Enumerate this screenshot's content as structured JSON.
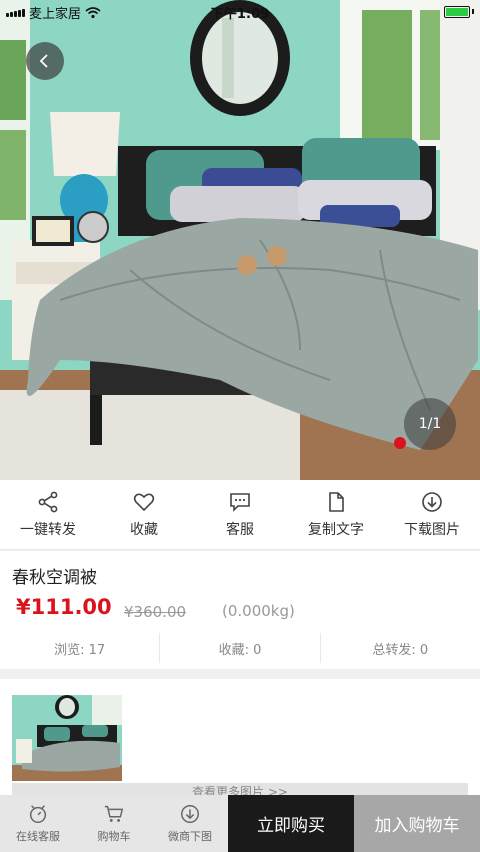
{
  "status_bar": {
    "carrier": "麦上家居",
    "time": "下午1:09"
  },
  "gallery": {
    "counter": "1/1",
    "back_icon": "chevron-left-icon"
  },
  "actions": [
    {
      "label": "一键转发",
      "icon": "share-icon"
    },
    {
      "label": "收藏",
      "icon": "heart-icon"
    },
    {
      "label": "客服",
      "icon": "chat-icon"
    },
    {
      "label": "复制文字",
      "icon": "copy-icon"
    },
    {
      "label": "下载图片",
      "icon": "download-icon"
    }
  ],
  "product": {
    "title": "春秋空调被",
    "price": "¥111.00",
    "original_price": "¥360.00",
    "weight": "(0.000kg)",
    "price_color": "#d9141c"
  },
  "stats": {
    "views": "浏览: 17",
    "favorites": "收藏: 0",
    "forwards": "总转发: 0"
  },
  "more_images": {
    "label": "查看更多图片 >>"
  },
  "bottom_bar": {
    "tabs": [
      {
        "label": "在线客服",
        "icon": "customer-service-icon"
      },
      {
        "label": "购物车",
        "icon": "cart-icon"
      },
      {
        "label": "微商下图",
        "icon": "download-icon"
      }
    ],
    "buy_now": "立即购买",
    "add_to_cart": "加入购物车"
  }
}
